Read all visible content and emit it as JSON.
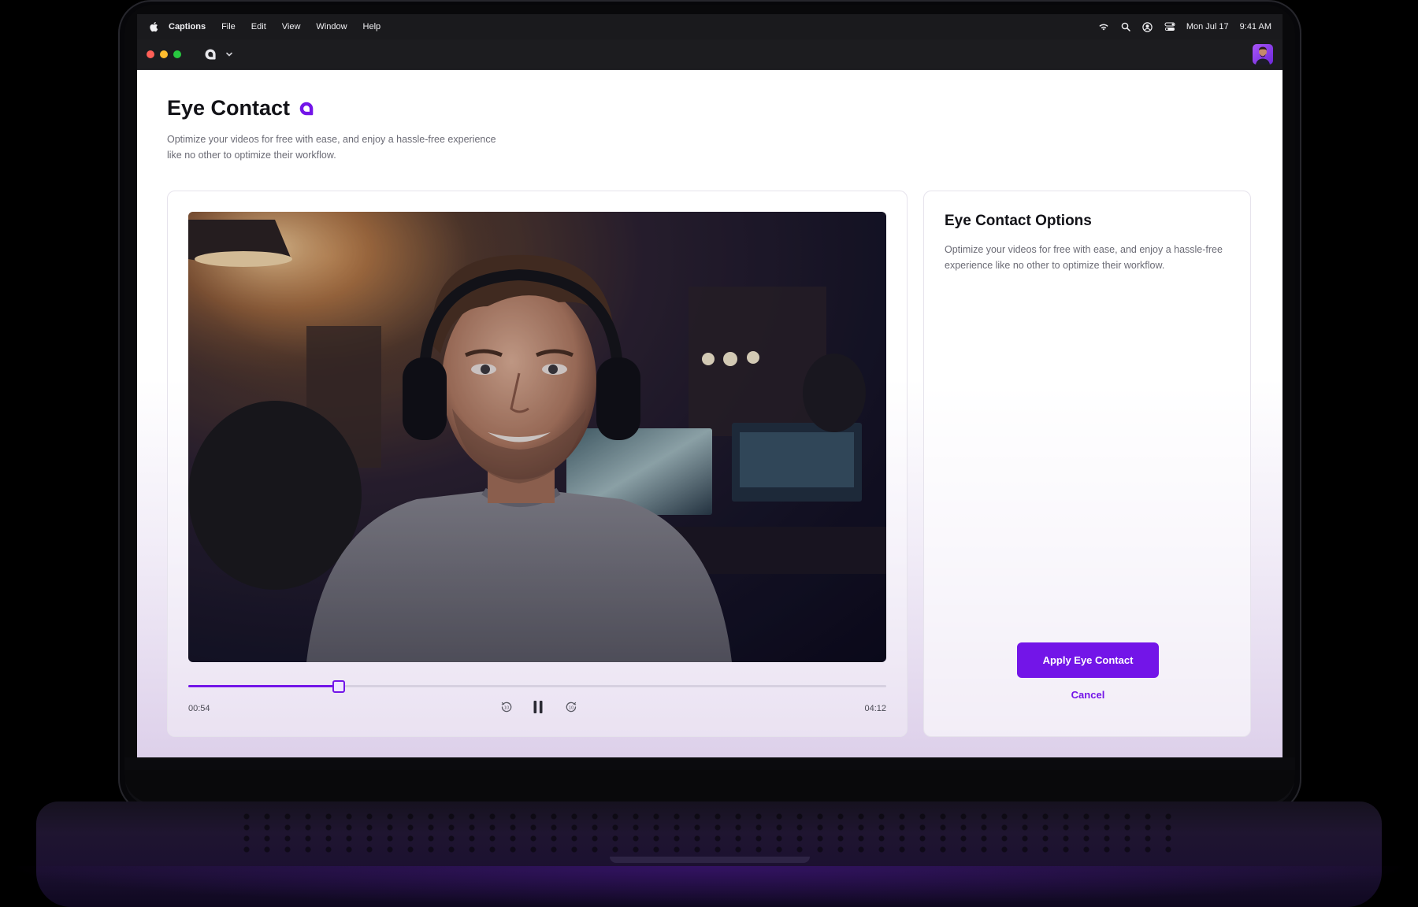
{
  "menubar": {
    "app_name": "Captions",
    "items": [
      "File",
      "Edit",
      "View",
      "Window",
      "Help"
    ],
    "date": "Mon Jul 17",
    "time": "9:41 AM"
  },
  "page": {
    "title": "Eye Contact",
    "subtitle": "Optimize your videos for free with ease, and enjoy a hassle-free experience like no other to optimize their workflow."
  },
  "player": {
    "current_time": "00:54",
    "total_time": "04:12",
    "progress": 0.215
  },
  "options": {
    "title": "Eye Contact Options",
    "description": "Optimize your videos for free with ease, and enjoy a hassle-free experience like no other to optimize their workflow.",
    "apply_label": "Apply Eye Contact",
    "cancel_label": "Cancel"
  },
  "colors": {
    "accent": "#7315e8",
    "text_primary": "#121217",
    "text_secondary": "#6b6b75"
  },
  "icons": {
    "menubar_left": "apple-icon",
    "menubar_right": [
      "wifi-icon",
      "search-icon",
      "user-circle-icon",
      "control-center-icon"
    ],
    "player_controls": [
      "rewind-10-icon",
      "pause-icon",
      "forward-10-icon"
    ]
  }
}
